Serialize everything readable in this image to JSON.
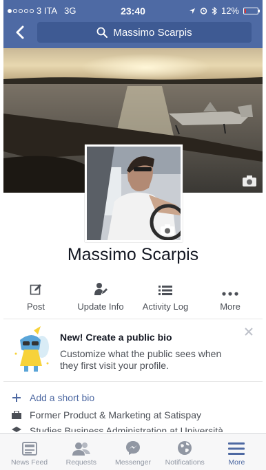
{
  "status_bar": {
    "carrier": "3 ITA",
    "network": "3G",
    "time": "23:40",
    "battery": "12%",
    "battery_level": 0.12,
    "signal_bars_filled": 1,
    "signal_bars_total": 5
  },
  "nav": {
    "search_text": "Massimo Scarpis"
  },
  "profile": {
    "name": "Massimo Scarpis"
  },
  "actions": [
    {
      "label": "Post",
      "icon": "edit-icon"
    },
    {
      "label": "Update Info",
      "icon": "update-info-icon"
    },
    {
      "label": "Activity Log",
      "icon": "list-icon"
    },
    {
      "label": "More",
      "icon": "more-dots-icon"
    }
  ],
  "bio_card": {
    "title": "New! Create a public bio",
    "text": "Customize what the public sees when they first visit your profile."
  },
  "info": {
    "add_bio": "Add a short bio",
    "work": "Former Product & Marketing at Satispay",
    "study": "Studies Business Administration at Università"
  },
  "tabs": [
    {
      "label": "News Feed",
      "icon": "news-feed-icon",
      "active": false
    },
    {
      "label": "Requests",
      "icon": "requests-icon",
      "active": false
    },
    {
      "label": "Messenger",
      "icon": "messenger-icon",
      "active": false
    },
    {
      "label": "Notifications",
      "icon": "globe-icon",
      "active": false
    },
    {
      "label": "More",
      "icon": "menu-icon",
      "active": true
    }
  ],
  "colors": {
    "brand_blue": "#4e6aa4",
    "link_blue": "#4e69a2",
    "tab_inactive": "#9197a3",
    "battery_low": "#e33333"
  }
}
